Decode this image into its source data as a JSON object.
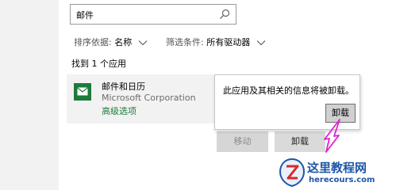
{
  "search": {
    "value": "邮件",
    "icon": "search-icon"
  },
  "filters": {
    "sort_label": "排序依据:",
    "sort_value": "名称",
    "filter_label": "筛选条件:",
    "filter_value": "所有驱动器"
  },
  "results": {
    "count_text": "找到 1 个应用"
  },
  "app": {
    "name": "邮件和日历",
    "publisher": "Microsoft Corporation",
    "advanced_link": "高级选项",
    "icon": "mail-app-icon",
    "icon_color": "#1e7a3c"
  },
  "buttons": {
    "move": "移动",
    "uninstall": "卸载"
  },
  "popup": {
    "message": "此应用及其相关的信息将被卸载。",
    "confirm": "卸载"
  },
  "watermark": {
    "title": "这里教程网",
    "url": "herecours.com"
  },
  "colors": {
    "accent": "#1e7a3c",
    "cursor": "#e021d4",
    "watermark": "#1d56a8"
  }
}
